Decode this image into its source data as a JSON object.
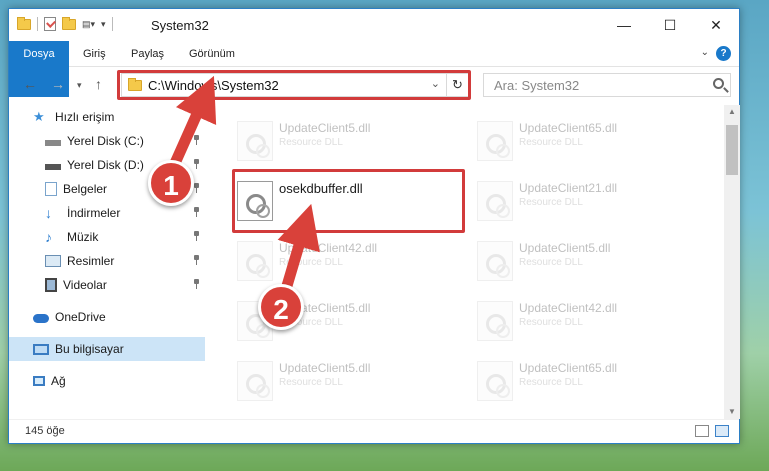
{
  "window": {
    "title": "System32",
    "controls": {
      "minimize": "—",
      "maximize": "☐",
      "close": "✕"
    }
  },
  "ribbon": {
    "tabs": [
      "Dosya",
      "Giriş",
      "Paylaş",
      "Görünüm"
    ],
    "help": "?"
  },
  "navigation": {
    "address": "C:\\Windows\\System32",
    "search_placeholder": "Ara: System32"
  },
  "sidebar": {
    "items": [
      {
        "label": "Hızlı erişim",
        "icon": "star-icon"
      },
      {
        "label": "Yerel Disk (C:)",
        "icon": "drive-icon",
        "pinned": true
      },
      {
        "label": "Yerel Disk (D:)",
        "icon": "drive-icon",
        "pinned": true
      },
      {
        "label": "Belgeler",
        "icon": "documents-icon",
        "pinned": true
      },
      {
        "label": "İndirmeler",
        "icon": "download-icon",
        "pinned": true
      },
      {
        "label": "Müzik",
        "icon": "music-icon",
        "pinned": true
      },
      {
        "label": "Resimler",
        "icon": "pictures-icon",
        "pinned": true
      },
      {
        "label": "Videolar",
        "icon": "video-icon",
        "pinned": true
      },
      {
        "label": "OneDrive",
        "icon": "cloud-icon"
      },
      {
        "label": "Bu bilgisayar",
        "icon": "computer-icon",
        "selected": true
      },
      {
        "label": "Ağ",
        "icon": "network-icon"
      }
    ]
  },
  "files": [
    {
      "name": "UpdateClient5.dll",
      "type": "Resource DLL"
    },
    {
      "name": "UpdateClient65.dll",
      "type": "Resource DLL"
    },
    {
      "name": "osekdbuffer.dll",
      "type": ""
    },
    {
      "name": "UpdateClient21.dll",
      "type": "Resource DLL"
    },
    {
      "name": "UpdateClient42.dll",
      "type": "Resource DLL"
    },
    {
      "name": "UpdateClient5.dll",
      "type": "Resource DLL"
    },
    {
      "name": "UpdateClient5.dll",
      "type": "Resource DLL"
    },
    {
      "name": "UpdateClient42.dll",
      "type": "Resource DLL"
    },
    {
      "name": "UpdateClient5.dll",
      "type": "Resource DLL"
    },
    {
      "name": "UpdateClient65.dll",
      "type": "Resource DLL"
    }
  ],
  "status": {
    "count": "145 öğe"
  },
  "annotations": {
    "step1": "1",
    "step2": "2",
    "color": "#d9413a"
  }
}
